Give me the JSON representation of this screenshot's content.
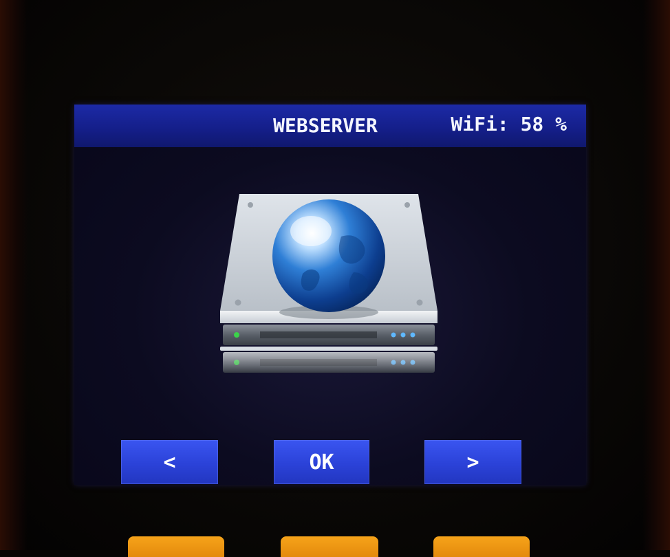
{
  "header": {
    "title": "WEBSERVER",
    "wifi_status": "WiFi: 58 %"
  },
  "main": {
    "icon": "webserver-globe-icon"
  },
  "nav": {
    "prev_label": "<",
    "ok_label": "OK",
    "next_label": ">"
  },
  "colors": {
    "titlebar": "#141e88",
    "button": "#2b42d8",
    "screen_bg": "#0c0b20",
    "hardware_key": "#f6a31a"
  }
}
